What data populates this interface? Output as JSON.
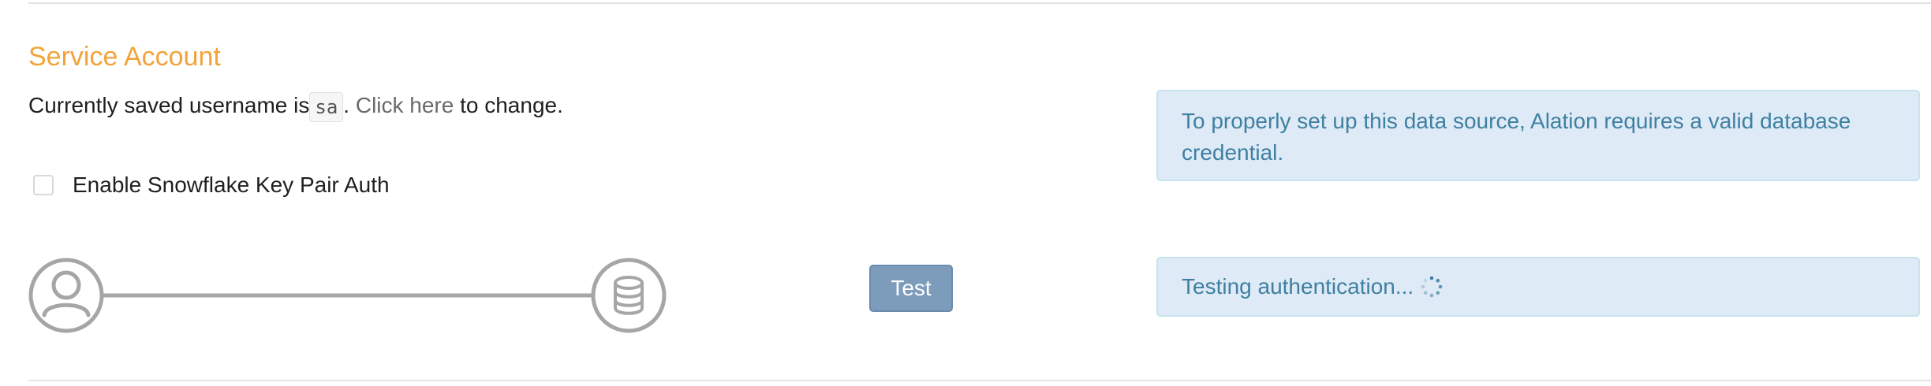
{
  "section": {
    "title": "Service Account"
  },
  "credentials": {
    "saved_prefix": "Currently saved username is",
    "username": "sa",
    "period": ". ",
    "change_link": "Click here",
    "change_suffix": " to change."
  },
  "key_pair": {
    "label": "Enable Snowflake Key Pair Auth",
    "checked": false
  },
  "connection": {
    "user_icon": "user-icon",
    "database_icon": "database-icon",
    "test_label": "Test"
  },
  "alerts": {
    "info": "To properly set up this data source, Alation requires a valid database credential.",
    "status": "Testing authentication...",
    "spinner_icon": "spinner-icon"
  },
  "colors": {
    "title": "#f2a33a",
    "alert_bg": "#deeaf6",
    "alert_text": "#3f80a2",
    "button_bg": "#7d9cbc",
    "connector": "#a6a6a6"
  }
}
